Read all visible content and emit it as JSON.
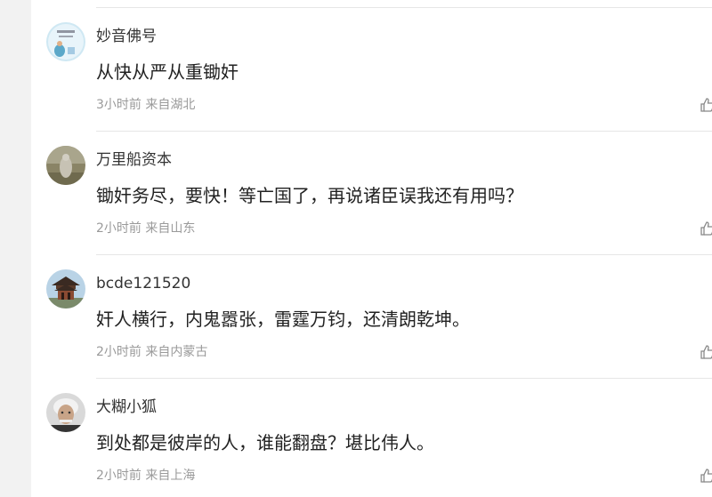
{
  "comments": [
    {
      "username": "妙音佛号",
      "content": "从快从严从重锄奸",
      "time": "3小时前",
      "location": "来自湖北",
      "avatar_icon": "calligraphy-avatar-icon"
    },
    {
      "username": "万里船资本",
      "content": "锄奸务尽，要快！等亡国了，再说诸臣误我还有用吗？",
      "time": "2小时前",
      "location": "来自山东",
      "avatar_icon": "stone-statue-avatar-icon"
    },
    {
      "username": "bcde121520",
      "content": "奸人横行，内鬼嚣张，雷霆万钧，还清朗乾坤。",
      "time": "2小时前",
      "location": "来自内蒙古",
      "avatar_icon": "pavilion-avatar-icon"
    },
    {
      "username": "大糊小狐",
      "content": "到处都是彼岸的人，谁能翻盘？堪比伟人。",
      "time": "2小时前",
      "location": "来自上海",
      "avatar_icon": "portrait-avatar-icon"
    }
  ],
  "colors": {
    "page_background": "#f2f2f2",
    "panel_background": "#ffffff",
    "username": "#333333",
    "content": "#222222",
    "meta": "#9a9a9a",
    "divider": "#e6e6e6"
  }
}
